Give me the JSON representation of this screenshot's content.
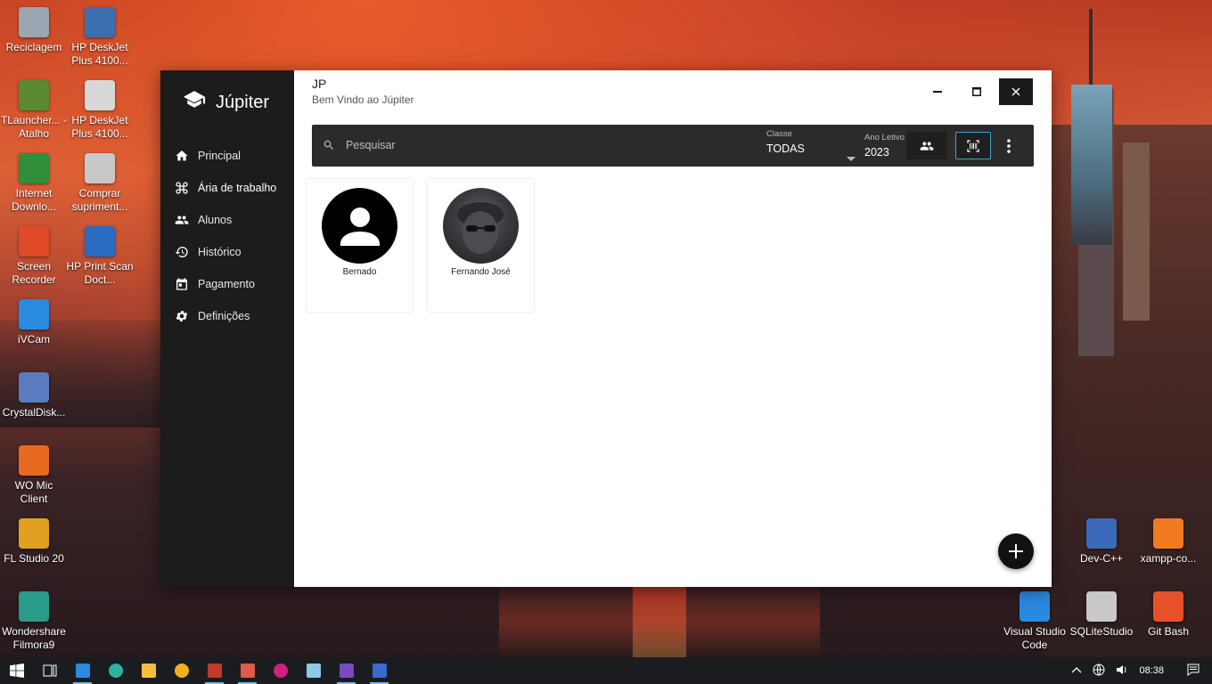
{
  "desktop": {
    "left_icons": [
      {
        "label": "Reciclagem",
        "icon": "recycle-bin-icon",
        "color": "#9aa6b2"
      },
      {
        "label": "HP DeskJet Plus 4100...",
        "icon": "printer-icon",
        "color": "#3b6fb0"
      },
      {
        "label": "TLauncher... - Atalho",
        "icon": "minecraft-icon",
        "color": "#5b8a32"
      },
      {
        "label": "HP DeskJet Plus 4100...",
        "icon": "printer-icon",
        "color": "#d8d8d8"
      },
      {
        "label": "Internet Downlo...",
        "icon": "idm-icon",
        "color": "#2f8f3a"
      },
      {
        "label": "Comprar supriment...",
        "icon": "printer-ink-icon",
        "color": "#c8c8c8"
      },
      {
        "label": "Screen Recorder",
        "icon": "screen-recorder-icon",
        "color": "#e04a28"
      },
      {
        "label": "HP Print Scan Doct...",
        "icon": "scan-doctor-icon",
        "color": "#2a6cc0"
      },
      {
        "label": "iVCam",
        "icon": "ivcam-icon",
        "color": "#2a8ae0"
      },
      {
        "label": "CrystalDisk...",
        "icon": "crystaldisk-icon",
        "color": "#5a7bc0"
      },
      {
        "label": "WO Mic Client",
        "icon": "microphone-icon",
        "color": "#e86a20"
      },
      {
        "label": "FL Studio 20",
        "icon": "fl-studio-icon",
        "color": "#e0a020"
      },
      {
        "label": "Wondershare Filmora9",
        "icon": "filmora-icon",
        "color": "#2a9a8a"
      }
    ],
    "right_icons": [
      {
        "label": "Dev-C++",
        "icon": "devcpp-icon",
        "color": "#3a6ab8"
      },
      {
        "label": "xampp-co...",
        "icon": "xampp-icon",
        "color": "#f07a20"
      },
      {
        "label": "Visual Studio Code",
        "icon": "vscode-icon",
        "color": "#2a8ae0"
      },
      {
        "label": "SQLiteStudio",
        "icon": "sqlite-icon",
        "color": "#c8c8c8"
      },
      {
        "label": "Git Bash",
        "icon": "git-bash-icon",
        "color": "#e8502a"
      }
    ]
  },
  "app": {
    "brand": "Júpiter",
    "title": "JP",
    "welcome": "Bem Vindo ao  Júpiter",
    "nav": [
      {
        "label": "Principal",
        "icon": "home-icon"
      },
      {
        "label": "Ária de trabalho",
        "icon": "command-icon"
      },
      {
        "label": "Alunos",
        "icon": "people-icon"
      },
      {
        "label": "Histórico",
        "icon": "history-icon"
      },
      {
        "label": "Pagamento",
        "icon": "calendar-icon"
      },
      {
        "label": "Definições",
        "icon": "gear-icon"
      }
    ],
    "toolbar": {
      "search_placeholder": "Pesquisar",
      "classe_label": "Classe",
      "classe_value": "TODAS",
      "ano_label": "Ano Letivo",
      "ano_value": "2023"
    },
    "students": [
      {
        "name": "Bernado",
        "avatar": "default-avatar"
      },
      {
        "name": "Fernando José",
        "avatar": "photo"
      }
    ]
  },
  "taskbar": {
    "items": [
      "start-icon",
      "task-view-icon",
      "vscode-icon",
      "edge-icon",
      "file-explorer-icon",
      "app-icon",
      "access-icon",
      "layers-icon",
      "app-icon",
      "notepad-icon",
      "visual-studio-icon",
      "app-icon"
    ],
    "time": "08:38"
  }
}
